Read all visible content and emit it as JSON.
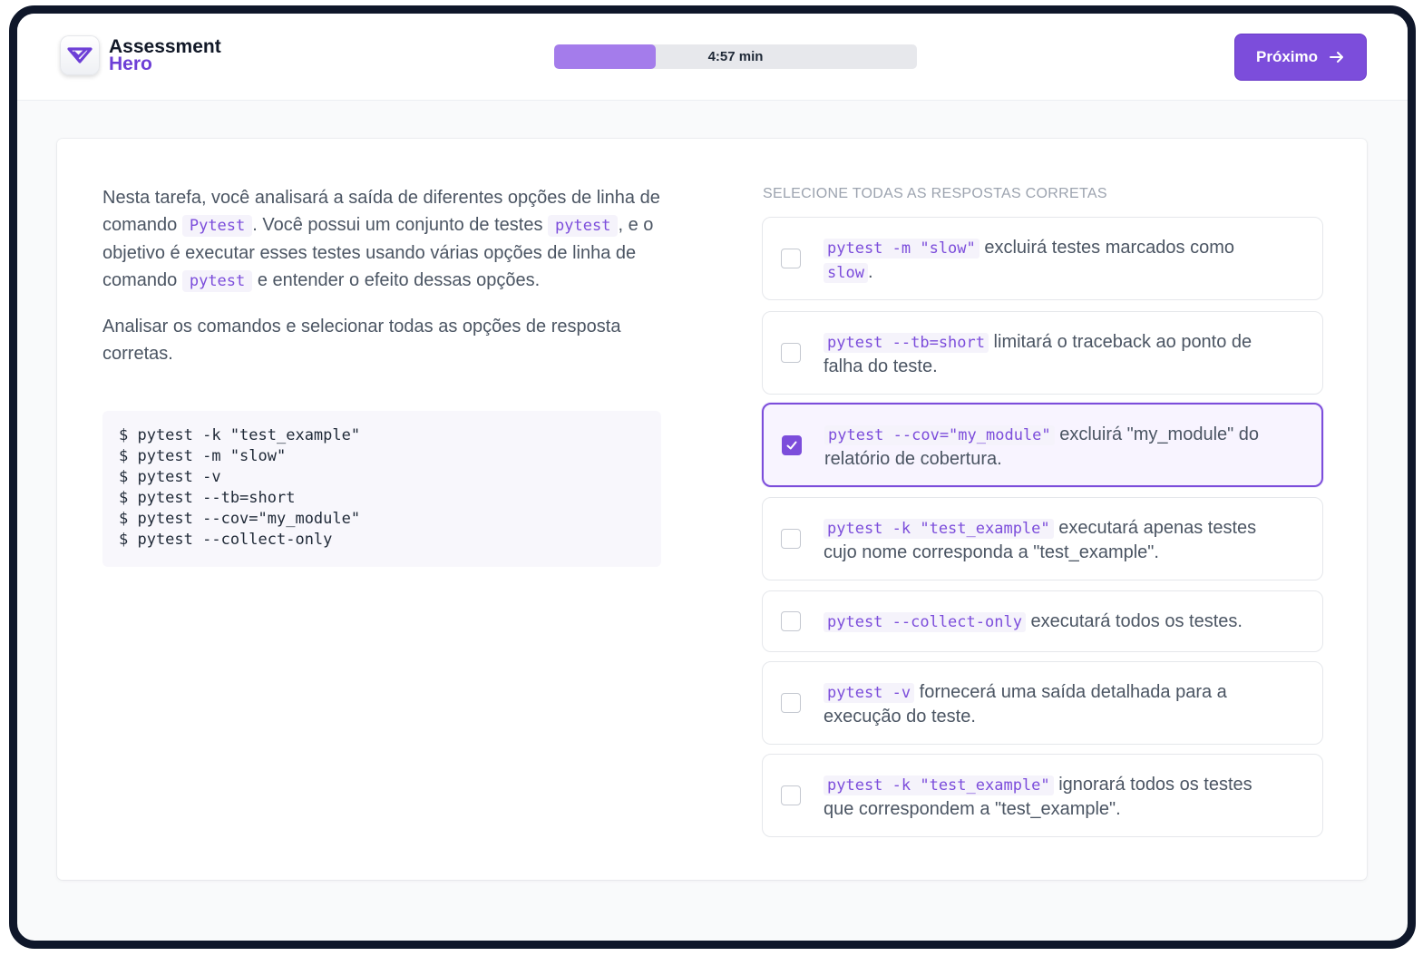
{
  "header": {
    "logo_line1": "Assessment",
    "logo_line2": "Hero",
    "timer_label": "4:57 min",
    "progress_fraction": 0.28,
    "next_label": "Próximo"
  },
  "prompt": {
    "p1_a": "Nesta tarefa, você analisará a saída de diferentes opções de linha de comando ",
    "p1_code1": "Pytest",
    "p1_b": ". Você possui um conjunto de testes ",
    "p1_code2": "pytest",
    "p1_c": ", e o objetivo é executar esses testes usando várias opções de linha de comando ",
    "p1_code3": "pytest",
    "p1_d": " e entender o efeito dessas opções.",
    "p2": "Analisar os comandos e selecionar todas as opções de resposta corretas.",
    "code_lines": [
      "$ pytest -k \"test_example\"",
      "$ pytest -m \"slow\"",
      "$ pytest -v",
      "$ pytest --tb=short",
      "$ pytest --cov=\"my_module\"",
      "$ pytest --collect-only"
    ]
  },
  "question": {
    "instruction": "SELECIONE TODAS AS RESPOSTAS CORRETAS",
    "options": [
      {
        "code": "pytest -m \"slow\"",
        "text": " excluirá testes marcados como ",
        "code2": "slow",
        "text2": ".",
        "selected": false
      },
      {
        "code": "pytest --tb=short",
        "text": " limitará o traceback ao ponto de falha do teste.",
        "code2": "",
        "text2": "",
        "selected": false
      },
      {
        "code": "pytest --cov=\"my_module\"",
        "text": " excluirá \"my_module\" do relatório de cobertura.",
        "code2": "",
        "text2": "",
        "selected": true
      },
      {
        "code": "pytest -k \"test_example\"",
        "text": " executará apenas testes cujo nome corresponda a \"test_example\".",
        "code2": "",
        "text2": "",
        "selected": false
      },
      {
        "code": "pytest --collect-only",
        "text": " executará todos os testes.",
        "code2": "",
        "text2": "",
        "selected": false
      },
      {
        "code": "pytest -v",
        "text": " fornecerá uma saída detalhada para a execução do teste.",
        "code2": "",
        "text2": "",
        "selected": false
      },
      {
        "code": "pytest -k \"test_example\"",
        "text": " ignorará todos os testes que correspondem a \"test_example\".",
        "code2": "",
        "text2": "",
        "selected": false
      }
    ]
  },
  "colors": {
    "accent": "#7c4ddb",
    "progress_fill": "#a47ceb",
    "frame": "#0f172a"
  },
  "icons": {
    "logo": "checkmark-badge-icon",
    "next": "arrow-right-icon",
    "checkbox_checked": "checkmark-icon"
  }
}
